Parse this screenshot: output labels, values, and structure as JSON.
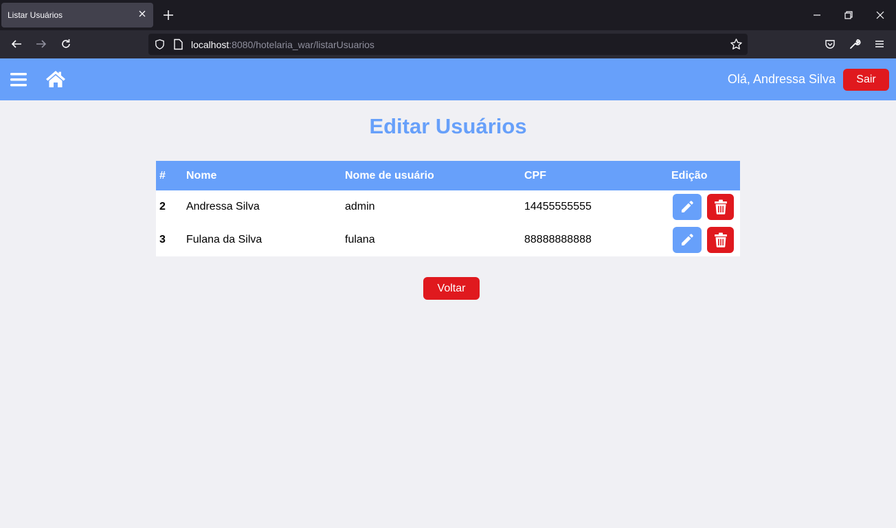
{
  "browser": {
    "tab_title": "Listar Usuários",
    "url_host": "localhost",
    "url_rest": ":8080/hotelaria_war/listarUsuarios"
  },
  "header": {
    "greeting": "Olá, Andressa Silva",
    "logout_label": "Sair"
  },
  "main": {
    "title": "Editar Usuários",
    "table": {
      "columns": [
        "#",
        "Nome",
        "Nome de usuário",
        "CPF",
        "Edição"
      ],
      "rows": [
        {
          "id": "2",
          "nome": "Andressa Silva",
          "usuario": "admin",
          "cpf": "14455555555"
        },
        {
          "id": "3",
          "nome": "Fulana da Silva",
          "usuario": "fulana",
          "cpf": "88888888888"
        }
      ]
    },
    "back_label": "Voltar"
  },
  "colors": {
    "primary": "#67a0fa",
    "danger": "#e0191e",
    "background": "#f0f0f4"
  },
  "icons": [
    "menu-icon",
    "home-icon",
    "pencil-icon",
    "trash-icon"
  ]
}
